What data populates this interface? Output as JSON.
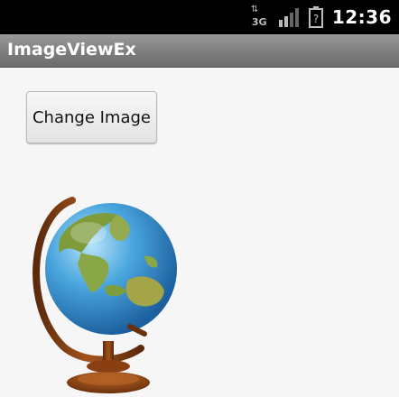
{
  "status_bar": {
    "network_type": "3G",
    "time": "12:36"
  },
  "title_bar": {
    "title": "ImageViewEx"
  },
  "main": {
    "change_image_button": "Change Image"
  },
  "icons": [
    "network-3g-icon",
    "signal-icon",
    "battery-icon",
    "globe-image"
  ],
  "colors": {
    "status_bar": "#000000",
    "title_bar": "#7b7b7b",
    "background": "#f6f6f6"
  }
}
